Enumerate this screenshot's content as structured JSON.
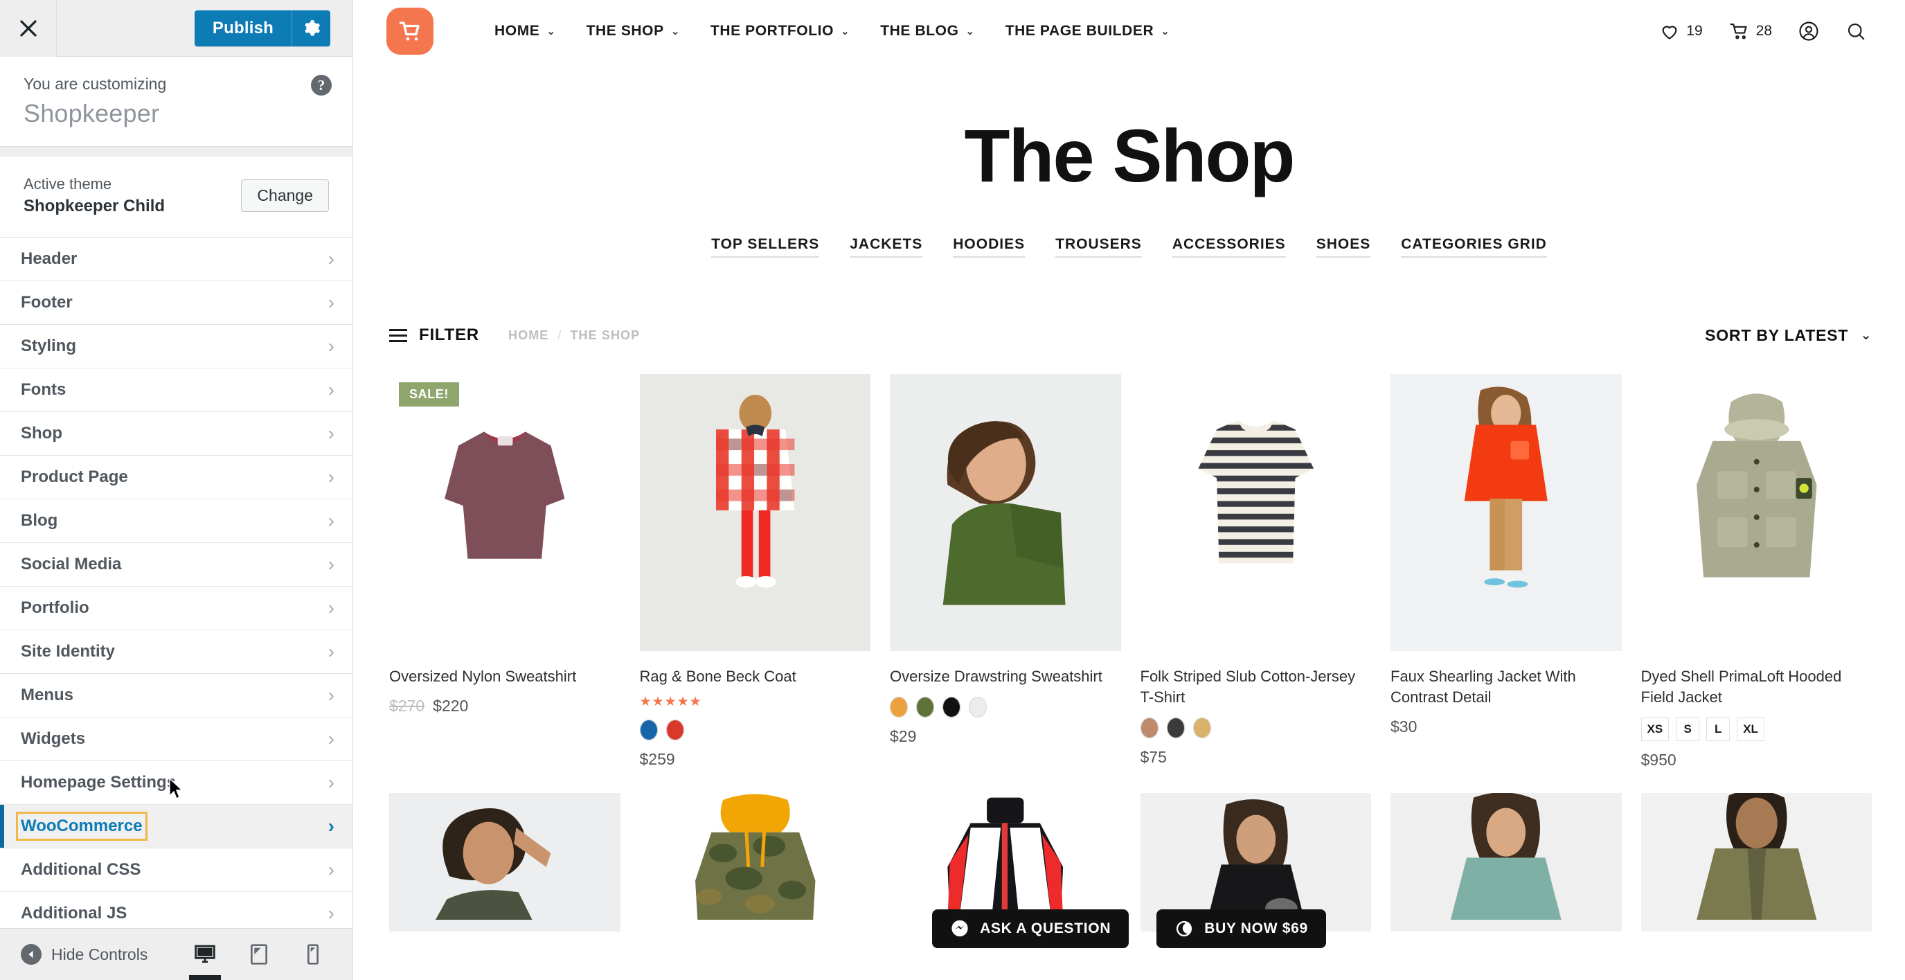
{
  "customizer": {
    "close_icon": "close-icon",
    "publish_label": "Publish",
    "gear_icon": "gear-icon",
    "info_label": "You are customizing",
    "info_title": "Shopkeeper",
    "help_icon": "help-icon",
    "theme_label": "Active theme",
    "theme_name": "Shopkeeper Child",
    "change_label": "Change",
    "items": [
      {
        "label": "Header",
        "active": false
      },
      {
        "label": "Footer",
        "active": false
      },
      {
        "label": "Styling",
        "active": false
      },
      {
        "label": "Fonts",
        "active": false
      },
      {
        "label": "Shop",
        "active": false
      },
      {
        "label": "Product Page",
        "active": false
      },
      {
        "label": "Blog",
        "active": false
      },
      {
        "label": "Social Media",
        "active": false
      },
      {
        "label": "Portfolio",
        "active": false
      },
      {
        "label": "Site Identity",
        "active": false
      },
      {
        "label": "Menus",
        "active": false
      },
      {
        "label": "Widgets",
        "active": false
      },
      {
        "label": "Homepage Settings",
        "active": false
      },
      {
        "label": "WooCommerce",
        "active": true
      },
      {
        "label": "Additional CSS",
        "active": false
      },
      {
        "label": "Additional JS",
        "active": false
      }
    ],
    "hide_controls_label": "Hide Controls",
    "devices": [
      {
        "name": "desktop",
        "active": true
      },
      {
        "name": "tablet",
        "active": false
      },
      {
        "name": "mobile",
        "active": false
      }
    ]
  },
  "preview": {
    "logo_icon": "cart-logo-icon",
    "nav": [
      {
        "label": "HOME",
        "has_caret": true
      },
      {
        "label": "THE SHOP",
        "has_caret": true
      },
      {
        "label": "THE PORTFOLIO",
        "has_caret": true
      },
      {
        "label": "THE BLOG",
        "has_caret": true
      },
      {
        "label": "THE PAGE BUILDER",
        "has_caret": true
      }
    ],
    "header_right": {
      "wishlist_count": "19",
      "cart_count": "28",
      "account_icon": "account-icon",
      "search_icon": "search-icon"
    },
    "page_title": "The Shop",
    "categories": [
      "TOP SELLERS",
      "JACKETS",
      "HOODIES",
      "TROUSERS",
      "ACCESSORIES",
      "SHOES",
      "CATEGORIES GRID"
    ],
    "toolbar": {
      "filter_label": "FILTER",
      "breadcrumb_home": "HOME",
      "breadcrumb_sep": "/",
      "breadcrumb_current": "THE SHOP",
      "sort_label": "SORT BY LATEST"
    },
    "products": [
      {
        "title": "Oversized Nylon Sweatshirt",
        "badge": "SALE!",
        "old_price": "$270",
        "price": "$220",
        "rating": null,
        "swatches": [],
        "sizes": []
      },
      {
        "title": "Rag & Bone Beck Coat",
        "badge": null,
        "old_price": null,
        "price": "$259",
        "rating": "★★★★★",
        "swatches": [
          "#1565a8",
          "#d8392b"
        ],
        "sizes": []
      },
      {
        "title": "Oversize Drawstring Sweatshirt",
        "badge": null,
        "old_price": null,
        "price": "$29",
        "rating": null,
        "swatches": [
          "#eba13f",
          "#5f7338",
          "#111111",
          "#ececec"
        ],
        "sizes": []
      },
      {
        "title": "Folk Striped Slub Cotton-Jersey T-Shirt",
        "badge": null,
        "old_price": null,
        "price": "$75",
        "rating": null,
        "swatches": [
          "#c08a6e",
          "#3b3b3b",
          "#d9b36c"
        ],
        "sizes": []
      },
      {
        "title": "Faux Shearling Jacket With Contrast Detail",
        "badge": null,
        "old_price": null,
        "price": "$30",
        "rating": null,
        "swatches": [],
        "sizes": []
      },
      {
        "title": "Dyed Shell PrimaLoft Hooded Field Jacket",
        "badge": null,
        "old_price": null,
        "price": "$950",
        "rating": null,
        "swatches": [],
        "sizes": [
          "XS",
          "S",
          "L",
          "XL"
        ]
      }
    ],
    "floating_buttons": [
      {
        "label": "ASK A QUESTION",
        "icon": "messenger-icon"
      },
      {
        "label": "BUY NOW $69",
        "icon": "envato-icon"
      }
    ]
  },
  "colors": {
    "publish_blue": "#0d7cb5",
    "focus_yellow": "#f0b849",
    "accent_orange": "#f4764f",
    "sale_green": "#8ea56b",
    "dark_button": "#111111"
  }
}
